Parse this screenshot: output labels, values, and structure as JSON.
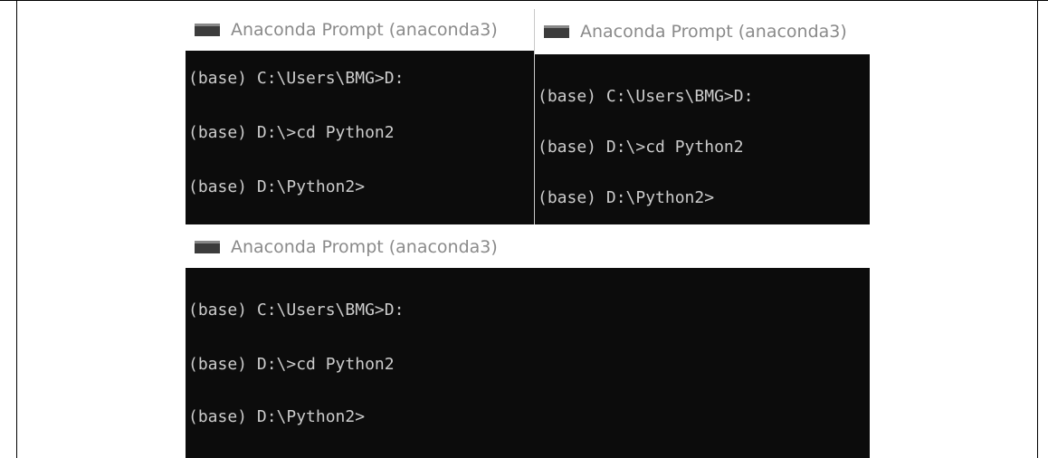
{
  "windows": [
    {
      "title": "Anaconda Prompt (anaconda3)",
      "lines": [
        "(base) C:\\Users\\BMG>D:",
        "(base) D:\\>cd Python2",
        "(base) D:\\Python2>"
      ]
    },
    {
      "title": "Anaconda Prompt (anaconda3)",
      "lines": [
        "(base) C:\\Users\\BMG>D:",
        "(base) D:\\>cd Python2",
        "(base) D:\\Python2>"
      ]
    },
    {
      "title": "Anaconda Prompt (anaconda3)",
      "lines": [
        "(base) C:\\Users\\BMG>D:",
        "(base) D:\\>cd Python2",
        "(base) D:\\Python2>"
      ]
    }
  ],
  "colors": {
    "console_bg": "#0c0c0c",
    "console_text": "#cccccc",
    "title_text": "#8a8a8a"
  },
  "icons": {
    "window_icon": "terminal-icon"
  }
}
